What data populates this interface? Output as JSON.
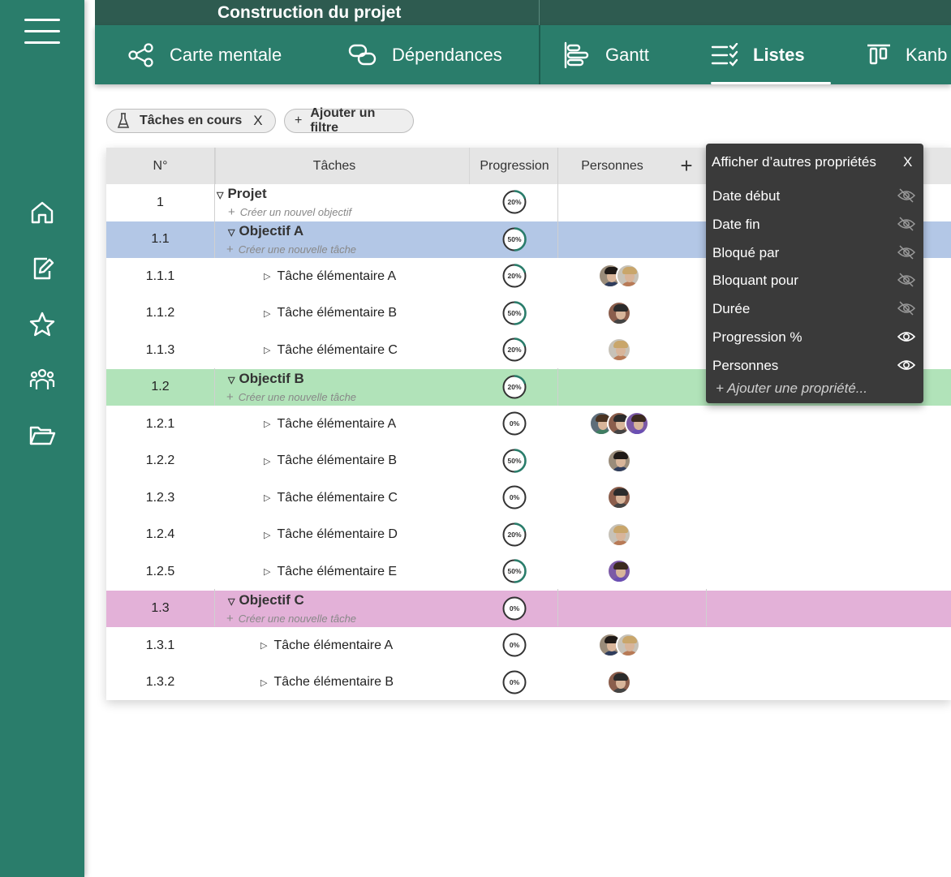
{
  "app": {
    "title": "Construction du projet"
  },
  "sidebar": {
    "items": [
      {
        "icon": "menu-icon"
      },
      {
        "icon": "home-icon"
      },
      {
        "icon": "edit-document-icon"
      },
      {
        "icon": "star-icon"
      },
      {
        "icon": "team-icon"
      },
      {
        "icon": "folder-icon"
      }
    ]
  },
  "tabs": [
    {
      "label": "Carte mentale",
      "icon": "mind-map-icon"
    },
    {
      "label": "Dépendances",
      "icon": "dependencies-icon"
    },
    {
      "label": "Gantt",
      "icon": "gantt-icon"
    },
    {
      "label": "Listes",
      "icon": "list-icon",
      "active": true
    },
    {
      "label": "Kanb",
      "icon": "kanban-icon"
    }
  ],
  "filters": {
    "active_filter": "Tâches en cours",
    "remove": "X",
    "add_plus": "+",
    "add_filter": "Ajouter un filtre"
  },
  "table": {
    "headers": {
      "num": "N°",
      "tasks": "Tâches",
      "progress": "Progression",
      "people": "Personnes",
      "add": "+"
    },
    "rows": [
      {
        "num": "1",
        "title": "Projet",
        "sub": "Créer un nouvel objectif",
        "progress": "20%",
        "value": 0.2,
        "kind": "group",
        "color": "#ffffff",
        "avatars": 0
      },
      {
        "num": "1.1",
        "title": "Objectif A",
        "sub": "Créer une nouvelle tâche",
        "progress": "50%",
        "value": 0.5,
        "kind": "group",
        "color": "#b3c7e6",
        "avatars": 0
      },
      {
        "num": "1.1.1",
        "title": "Tâche élémentaire A",
        "progress": "20%",
        "value": 0.2,
        "kind": "task",
        "avatars": 2
      },
      {
        "num": "1.1.2",
        "title": "Tâche élémentaire B",
        "progress": "50%",
        "value": 0.5,
        "kind": "task",
        "avatars": 1
      },
      {
        "num": "1.1.3",
        "title": "Tâche élémentaire C",
        "progress": "20%",
        "value": 0.2,
        "kind": "task",
        "avatars": 1
      },
      {
        "num": "1.2",
        "title": "Objectif B",
        "sub": "Créer une nouvelle tâche",
        "progress": "20%",
        "value": 0.2,
        "kind": "group",
        "color": "#b1e3b9",
        "avatars": 0
      },
      {
        "num": "1.2.1",
        "title": "Tâche élémentaire A",
        "progress": "0%",
        "value": 0,
        "kind": "task",
        "avatars": 3
      },
      {
        "num": "1.2.2",
        "title": "Tâche élémentaire B",
        "progress": "50%",
        "value": 0.5,
        "kind": "task",
        "avatars": 1
      },
      {
        "num": "1.2.3",
        "title": "Tâche élémentaire C",
        "progress": "0%",
        "value": 0,
        "kind": "task",
        "avatars": 1
      },
      {
        "num": "1.2.4",
        "title": "Tâche élémentaire D",
        "progress": "20%",
        "value": 0.2,
        "kind": "task",
        "avatars": 1
      },
      {
        "num": "1.2.5",
        "title": "Tâche élémentaire E",
        "progress": "50%",
        "value": 0.5,
        "kind": "task",
        "avatars": 1
      },
      {
        "num": "1.3",
        "title": "Objectif C",
        "sub": "Créer une nouvelle tâche",
        "progress": "0%",
        "value": 0,
        "kind": "group",
        "color": "#e3b1d8",
        "avatars": 0
      },
      {
        "num": "1.3.1",
        "title": "Tâche élémentaire A",
        "progress": "0%",
        "value": 0,
        "kind": "task",
        "avatars": 2
      },
      {
        "num": "1.3.2",
        "title": "Tâche élémentaire B",
        "progress": "0%",
        "value": 0,
        "kind": "task",
        "avatars": 1
      }
    ]
  },
  "properties_panel": {
    "title": "Afficher d’autres propriétés",
    "close": "X",
    "items": [
      {
        "label": "Date début",
        "visible": false
      },
      {
        "label": "Date fin",
        "visible": false
      },
      {
        "label": "Bloqué par",
        "visible": false
      },
      {
        "label": "Bloquant pour",
        "visible": false
      },
      {
        "label": "Durée",
        "visible": false
      },
      {
        "label": "Progression %",
        "visible": true
      },
      {
        "label": "Personnes",
        "visible": true
      }
    ],
    "add": "+ Ajouter une propriété..."
  },
  "colors": {
    "accent": "#2a7d6b",
    "header_dark": "#2e5b50",
    "progress_ring": "#2a7d6b"
  }
}
